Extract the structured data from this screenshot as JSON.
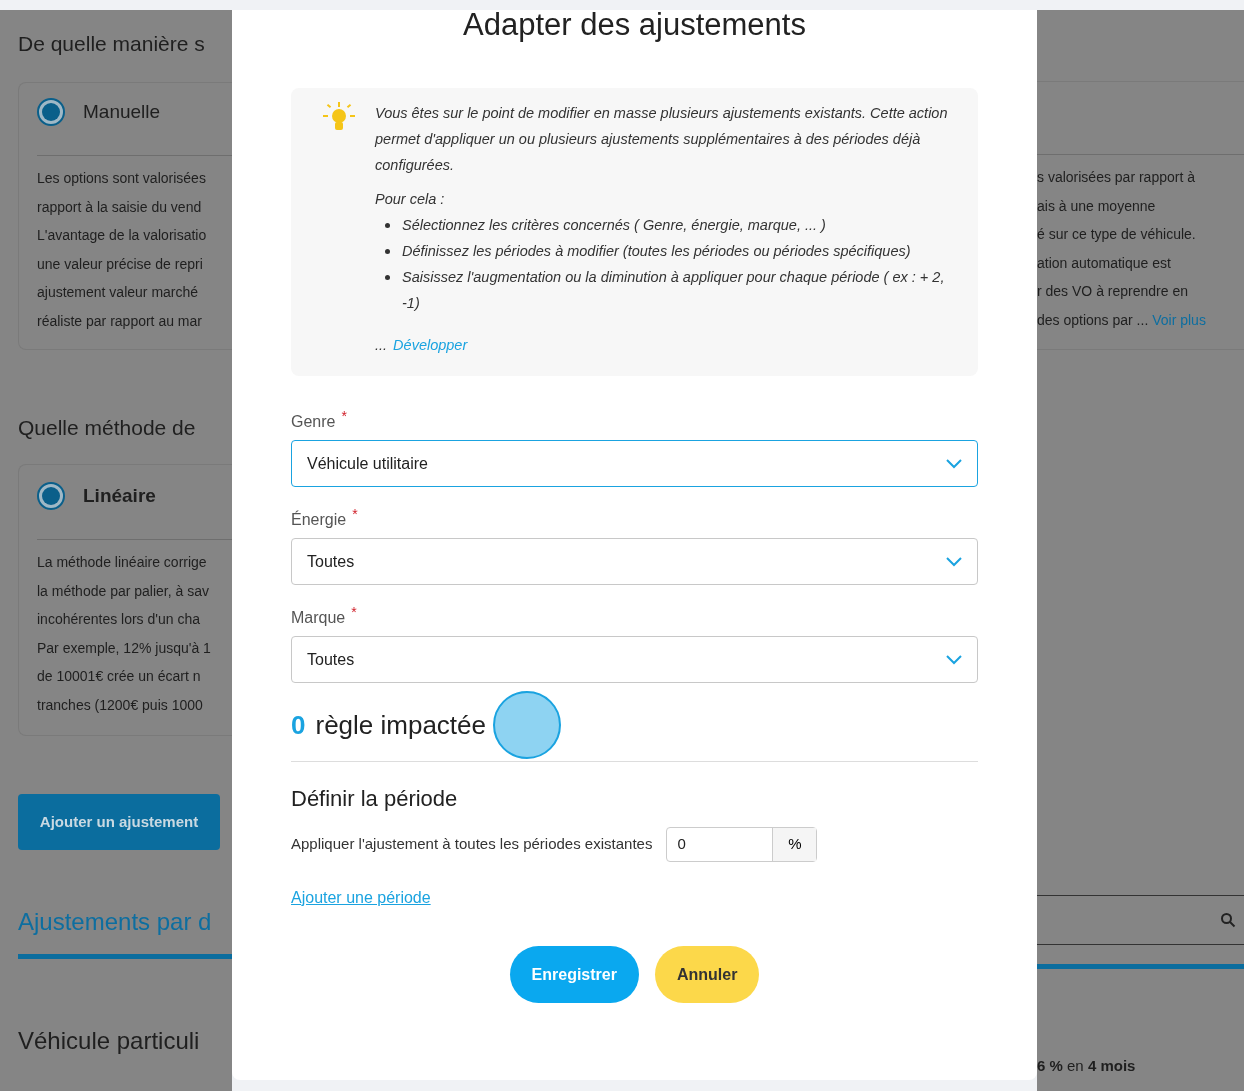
{
  "background": {
    "left": {
      "heading_1": "De quelle manière s",
      "option_1": {
        "label": "Manuelle",
        "selected": true
      },
      "description_1": [
        "Les options sont valorisées",
        "rapport à la saisie du vend",
        "L'avantage de la valorisatio",
        "une valeur précise de repri",
        "ajustement valeur marché",
        "réaliste par rapport au mar"
      ],
      "heading_2": "Quelle méthode de",
      "option_2": {
        "label": "Linéaire",
        "selected": true
      },
      "description_2": [
        "La méthode linéaire corrige",
        "la méthode par palier, à sav",
        "incohérentes lors d'un cha",
        "Par exemple, 12% jusqu'à 1",
        "de 10001€ crée un écart n",
        "tranches (1200€ puis 1000"
      ],
      "add_button": "Ajouter un ajustement",
      "section_title": "Ajustements par d",
      "subsection_title": "Véhicule particuli"
    },
    "right": {
      "description_1": [
        "s valorisées par rapport à",
        "ais à une moyenne",
        "é sur ce type de véhicule.",
        "ation automatique est",
        "r des VO à reprendre en",
        "des options par ..."
      ],
      "more_link": "Voir plus",
      "summary": "**6 %** en **4 mois**"
    }
  },
  "dialog": {
    "title": "Adapter des ajustements",
    "info": {
      "intro": "Vous êtes sur le point de modifier en masse plusieurs ajustements existants. Cette action permet d'appliquer un ou plusieurs ajustements supplémentaires à des périodes déjà configurées.",
      "lead": "Pour cela :",
      "bullets": [
        "Sélectionnez les critères concernés ( Genre, énergie, marque, ... )",
        "Définissez les périodes à modifier (toutes les périodes ou périodes spécifiques)",
        "Saisissez l'augmentation ou la diminution à appliquer pour chaque période ( ex : + 2, -1)"
      ],
      "ellipsis": "...",
      "expand_link": "Développer"
    },
    "fields": [
      {
        "label": "Genre",
        "required_mark": "*",
        "value": "Véhicule utilitaire",
        "focused": true
      },
      {
        "label": "Énergie",
        "required_mark": "*",
        "value": "Toutes",
        "focused": false
      },
      {
        "label": "Marque",
        "required_mark": "*",
        "value": "Toutes",
        "focused": false
      }
    ],
    "impact": {
      "count": "0",
      "label": "règle impactée"
    },
    "period": {
      "title": "Définir la période",
      "apply_label": "Appliquer l'ajustement à toutes les périodes existantes",
      "value": "0",
      "unit": "%"
    },
    "add_period_link": "Ajouter une période",
    "buttons": [
      {
        "label": "Enregistrer",
        "kind": "primary"
      },
      {
        "label": "Annuler",
        "kind": "secondary"
      }
    ]
  }
}
